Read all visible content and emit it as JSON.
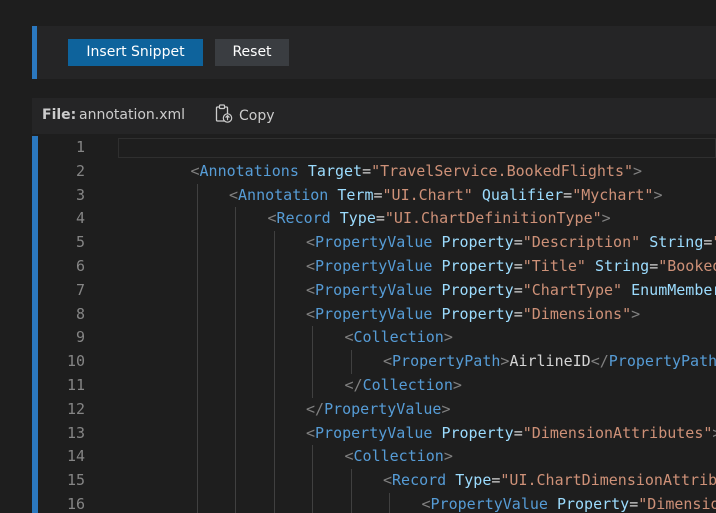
{
  "toolbar": {
    "insert_label": "Insert Snippet",
    "reset_label": "Reset"
  },
  "filebar": {
    "file_label": "File:",
    "file_name": "annotation.xml",
    "copy_label": "Copy"
  },
  "editor": {
    "line_numbers": [
      "1",
      "2",
      "3",
      "4",
      "5",
      "6",
      "7",
      "8",
      "9",
      "10",
      "11",
      "12",
      "13",
      "14",
      "15",
      "16"
    ],
    "lines": [
      {
        "indent": 0,
        "tokens": []
      },
      {
        "indent": 1,
        "tokens": [
          [
            "tb",
            "<"
          ],
          [
            "tg",
            "Annotations"
          ],
          [
            "tx",
            " "
          ],
          [
            "at",
            "Target"
          ],
          [
            "tx",
            "="
          ],
          [
            "st",
            "\"TravelService.BookedFlights\""
          ],
          [
            "tb",
            ">"
          ]
        ]
      },
      {
        "indent": 2,
        "tokens": [
          [
            "tb",
            "<"
          ],
          [
            "tg",
            "Annotation"
          ],
          [
            "tx",
            " "
          ],
          [
            "at",
            "Term"
          ],
          [
            "tx",
            "="
          ],
          [
            "st",
            "\"UI.Chart\""
          ],
          [
            "tx",
            " "
          ],
          [
            "at",
            "Qualifier"
          ],
          [
            "tx",
            "="
          ],
          [
            "st",
            "\"Mychart\""
          ],
          [
            "tb",
            ">"
          ]
        ]
      },
      {
        "indent": 3,
        "tokens": [
          [
            "tb",
            "<"
          ],
          [
            "tg",
            "Record"
          ],
          [
            "tx",
            " "
          ],
          [
            "at",
            "Type"
          ],
          [
            "tx",
            "="
          ],
          [
            "st",
            "\"UI.ChartDefinitionType\""
          ],
          [
            "tb",
            ">"
          ]
        ]
      },
      {
        "indent": 4,
        "tokens": [
          [
            "tb",
            "<"
          ],
          [
            "tg",
            "PropertyValue"
          ],
          [
            "tx",
            " "
          ],
          [
            "at",
            "Property"
          ],
          [
            "tx",
            "="
          ],
          [
            "st",
            "\"Description\""
          ],
          [
            "tx",
            " "
          ],
          [
            "at",
            "String"
          ],
          [
            "tx",
            "="
          ],
          [
            "st",
            "\""
          ]
        ]
      },
      {
        "indent": 4,
        "tokens": [
          [
            "tb",
            "<"
          ],
          [
            "tg",
            "PropertyValue"
          ],
          [
            "tx",
            " "
          ],
          [
            "at",
            "Property"
          ],
          [
            "tx",
            "="
          ],
          [
            "st",
            "\"Title\""
          ],
          [
            "tx",
            " "
          ],
          [
            "at",
            "String"
          ],
          [
            "tx",
            "="
          ],
          [
            "st",
            "\"Booked"
          ]
        ]
      },
      {
        "indent": 4,
        "tokens": [
          [
            "tb",
            "<"
          ],
          [
            "tg",
            "PropertyValue"
          ],
          [
            "tx",
            " "
          ],
          [
            "at",
            "Property"
          ],
          [
            "tx",
            "="
          ],
          [
            "st",
            "\"ChartType\""
          ],
          [
            "tx",
            " "
          ],
          [
            "at",
            "EnumMember="
          ]
        ]
      },
      {
        "indent": 4,
        "tokens": [
          [
            "tb",
            "<"
          ],
          [
            "tg",
            "PropertyValue"
          ],
          [
            "tx",
            " "
          ],
          [
            "at",
            "Property"
          ],
          [
            "tx",
            "="
          ],
          [
            "st",
            "\"Dimensions\""
          ],
          [
            "tb",
            ">"
          ]
        ]
      },
      {
        "indent": 5,
        "tokens": [
          [
            "tb",
            "<"
          ],
          [
            "tg",
            "Collection"
          ],
          [
            "tb",
            ">"
          ]
        ]
      },
      {
        "indent": 6,
        "tokens": [
          [
            "tb",
            "<"
          ],
          [
            "tg",
            "PropertyPath"
          ],
          [
            "tb",
            ">"
          ],
          [
            "tx",
            "AirlineID"
          ],
          [
            "tb",
            "</"
          ],
          [
            "tg",
            "PropertyPath"
          ],
          [
            "tb",
            ">"
          ]
        ]
      },
      {
        "indent": 5,
        "tokens": [
          [
            "tb",
            "</"
          ],
          [
            "tg",
            "Collection"
          ],
          [
            "tb",
            ">"
          ]
        ]
      },
      {
        "indent": 4,
        "tokens": [
          [
            "tb",
            "</"
          ],
          [
            "tg",
            "PropertyValue"
          ],
          [
            "tb",
            ">"
          ]
        ]
      },
      {
        "indent": 4,
        "tokens": [
          [
            "tb",
            "<"
          ],
          [
            "tg",
            "PropertyValue"
          ],
          [
            "tx",
            " "
          ],
          [
            "at",
            "Property"
          ],
          [
            "tx",
            "="
          ],
          [
            "st",
            "\"DimensionAttributes\""
          ],
          [
            "tb",
            ">"
          ]
        ]
      },
      {
        "indent": 5,
        "tokens": [
          [
            "tb",
            "<"
          ],
          [
            "tg",
            "Collection"
          ],
          [
            "tb",
            ">"
          ]
        ]
      },
      {
        "indent": 6,
        "tokens": [
          [
            "tb",
            "<"
          ],
          [
            "tg",
            "Record"
          ],
          [
            "tx",
            " "
          ],
          [
            "at",
            "Type"
          ],
          [
            "tx",
            "="
          ],
          [
            "st",
            "\"UI.ChartDimensionAttribu"
          ]
        ]
      },
      {
        "indent": 7,
        "tokens": [
          [
            "tb",
            "<"
          ],
          [
            "tg",
            "PropertyValue"
          ],
          [
            "tx",
            " "
          ],
          [
            "at",
            "Property"
          ],
          [
            "tx",
            "="
          ],
          [
            "st",
            "\"Dimension"
          ]
        ]
      }
    ]
  },
  "colors": {
    "accent": "#2b78bf",
    "primary_button": "#0e639c",
    "tag": "#569cd6",
    "attribute": "#9cdcfe",
    "string": "#ce9178"
  }
}
